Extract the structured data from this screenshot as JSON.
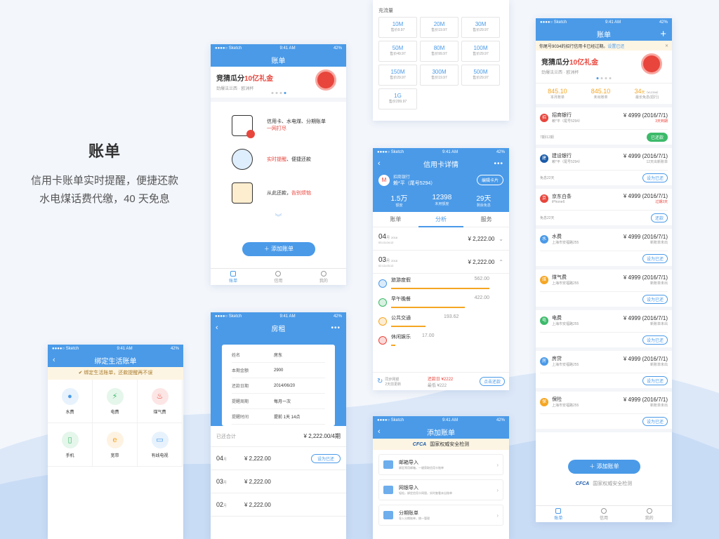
{
  "hero": {
    "title": "账单",
    "line1": "信用卡账单实时提醒，便捷还款",
    "line2": "水电煤话费代缴，40 天免息"
  },
  "statusbar": {
    "carrier": "●●●●○ Sketch",
    "time": "9:41 AM",
    "battery": "42%"
  },
  "s1": {
    "title": "账单",
    "banner_title_pre": "竞猜瓜分",
    "banner_title_hl": "10亿礼金",
    "banner_sub": "劲爆法兰西 · 欧洲杯",
    "features": [
      {
        "text": "信用卡、水电煤、分期账单",
        "hl": "一网打尽"
      },
      {
        "text": "",
        "hl": "实时提醒",
        "tail": "、便捷还款"
      },
      {
        "text": "从此还款，",
        "hl": "告别烦恼"
      }
    ],
    "add_label": "添加账单",
    "tabs": [
      "账单",
      "信用",
      "我的"
    ]
  },
  "s2": {
    "title": "房租",
    "fields": [
      {
        "k": "姓名",
        "v": "房东"
      },
      {
        "k": "本期金额",
        "v": "2900"
      },
      {
        "k": "还款日期",
        "v": "2014/06/20"
      },
      {
        "k": "提醒周期",
        "v": "每月一次"
      },
      {
        "k": "提醒时间",
        "v": "提前 1天 14点"
      }
    ],
    "total_label": "已还合计",
    "total_value": "¥ 2,222.00/4期",
    "rows": [
      {
        "m": "04",
        "u": "月",
        "amt": "¥ 2,222.00",
        "btn": "设为已还"
      },
      {
        "m": "03",
        "u": "月",
        "amt": "¥ 2,222.00",
        "btn": ""
      },
      {
        "m": "02",
        "u": "月",
        "amt": "¥ 2,222.00",
        "btn": ""
      }
    ]
  },
  "s3": {
    "title": "绑定生活账单",
    "notice": "绑定生活账单，还款提醒再不误",
    "items": [
      "水费",
      "电费",
      "煤气费",
      "手机",
      "宽带",
      "有线电视"
    ]
  },
  "s4": {
    "section": "充流量",
    "items": [
      {
        "a": "10M",
        "p": "售价9.97"
      },
      {
        "a": "20M",
        "p": "售价19.97"
      },
      {
        "a": "30M",
        "p": "售价29.97"
      },
      {
        "a": "50M",
        "p": "售价49.97"
      },
      {
        "a": "80M",
        "p": "售价99.97"
      },
      {
        "a": "100M",
        "p": "售价29.97"
      },
      {
        "a": "150M",
        "p": "售价29.97"
      },
      {
        "a": "300M",
        "p": "售价19.97"
      },
      {
        "a": "500M",
        "p": "售价29.97"
      },
      {
        "a": "1G",
        "p": "售价299.97"
      }
    ]
  },
  "s5": {
    "title": "信用卡详情",
    "bank": "招商银行",
    "holder": "赖*平（尾号5294）",
    "edit": "编辑卡片",
    "stats": [
      {
        "v": "1.5万",
        "k": "额度"
      },
      {
        "v": "12398",
        "k": "未用额度"
      },
      {
        "v": "29天",
        "k": "剩余免息"
      }
    ],
    "tabs": [
      "账单",
      "分析",
      "服务"
    ],
    "months": [
      {
        "m": "04",
        "u": "月",
        "y": "2016",
        "range": "03.13-04.12",
        "amt": "¥ 2,222.00"
      },
      {
        "m": "03",
        "u": "月",
        "y": "2016",
        "range": "02.13-03.12",
        "amt": "¥ 2,222.00"
      }
    ],
    "cats": [
      {
        "n": "旅游度假",
        "v": "562.00",
        "p": 100
      },
      {
        "n": "早午晚餐",
        "v": "422.00",
        "p": 75
      },
      {
        "n": "公共交通",
        "v": "193.62",
        "p": 35
      },
      {
        "n": "休闲娱乐",
        "v": "17.00",
        "p": 4
      }
    ],
    "sync_label": "同步网银",
    "sync_time": "2天前更新",
    "due": "还款日 ¥2222",
    "min": "最低 ¥222",
    "pay": "点击还款"
  },
  "s6": {
    "title": "添加账单",
    "cfca": "CFCA",
    "cfca_text": "国家权威安全检测",
    "items": [
      {
        "t": "邮箱导入",
        "s": "绑定常用邮箱，一键获取信用卡账单"
      },
      {
        "t": "网银导入",
        "s": "轻松，绑定信用卡网银，实时查看未出账单"
      },
      {
        "t": "分期账单",
        "s": "导入分期账单，统一管理"
      }
    ]
  },
  "s7": {
    "title": "账单",
    "notice": "你尾号9034的招行信用卡已经过期。",
    "notice_link": "设置已还",
    "banner_title_pre": "竞猜瓜分",
    "banner_title_hl": "10亿礼金",
    "banner_sub": "劲爆法兰西 · 欧洲杯",
    "stats": [
      {
        "v": "845.10",
        "k": "本月账单"
      },
      {
        "v": "845.10",
        "k": "未出账单"
      },
      {
        "v": "34",
        "u": "天",
        "extra": "（¥12398）",
        "k": "最长免息",
        "k2": "(招行)"
      }
    ],
    "bills": [
      {
        "icon": "招",
        "color": "#e8453c",
        "name": "招商银行",
        "sub": "赖*平（尾号5294）",
        "amt": "¥ 4999 (2016/7/1)",
        "status": "3天到期",
        "red": true,
        "foot": "7期/12期",
        "btn": "已还款",
        "green": true
      },
      {
        "icon": "建",
        "color": "#1a5aa8",
        "name": "建设银行",
        "sub": "赖*平（尾号5294）",
        "amt": "¥ 4999 (2016/7/1)",
        "status": "12天出新账单",
        "red": false,
        "foot": "免息22天",
        "btn": "设为已还",
        "green": false
      },
      {
        "icon": "京",
        "color": "#e8453c",
        "name": "京东白条",
        "sub": "iPhone6",
        "amt": "¥ 4999 (2016/7/1)",
        "status": "过期3天",
        "red": true,
        "foot": "免息22天",
        "btn": "还款",
        "green": false
      },
      {
        "icon": "水",
        "color": "#4a9ae8",
        "name": "水费",
        "sub": "上海市安福路255",
        "amt": "¥ 4999 (2016/7/1)",
        "status": "新账单未出",
        "red": false,
        "foot": "",
        "btn": "设为已还",
        "green": false
      },
      {
        "icon": "煤",
        "color": "#f5a623",
        "name": "煤气费",
        "sub": "上海市安福路255",
        "amt": "¥ 4999 (2016/7/1)",
        "status": "新账单未出",
        "red": false,
        "foot": "",
        "btn": "设为已还",
        "green": false
      },
      {
        "icon": "电",
        "color": "#3cba6a",
        "name": "电费",
        "sub": "上海市安福路255",
        "amt": "¥ 4999 (2016/7/1)",
        "status": "新账单未出",
        "red": false,
        "foot": "",
        "btn": "设为已还",
        "green": false
      },
      {
        "icon": "房",
        "color": "#4a9ae8",
        "name": "房贷",
        "sub": "上海市安福路255",
        "amt": "¥ 4999 (2016/7/1)",
        "status": "新账单未出",
        "red": false,
        "foot": "",
        "btn": "设为已还",
        "green": false
      },
      {
        "icon": "保",
        "color": "#f5a623",
        "name": "保险",
        "sub": "上海市安福路255",
        "amt": "¥ 4999 (2016/7/1)",
        "status": "新账单未出",
        "red": false,
        "foot": "",
        "btn": "设为已还",
        "green": false
      }
    ],
    "add_label": "添加账单",
    "cfca": "CFCA",
    "cfca_text": "国家权威安全检测",
    "tabs": [
      "账单",
      "信用",
      "我的"
    ]
  },
  "colors": {
    "primary": "#4a9ae8",
    "red": "#e8453c",
    "orange": "#f5a623",
    "green": "#3cba6a"
  }
}
